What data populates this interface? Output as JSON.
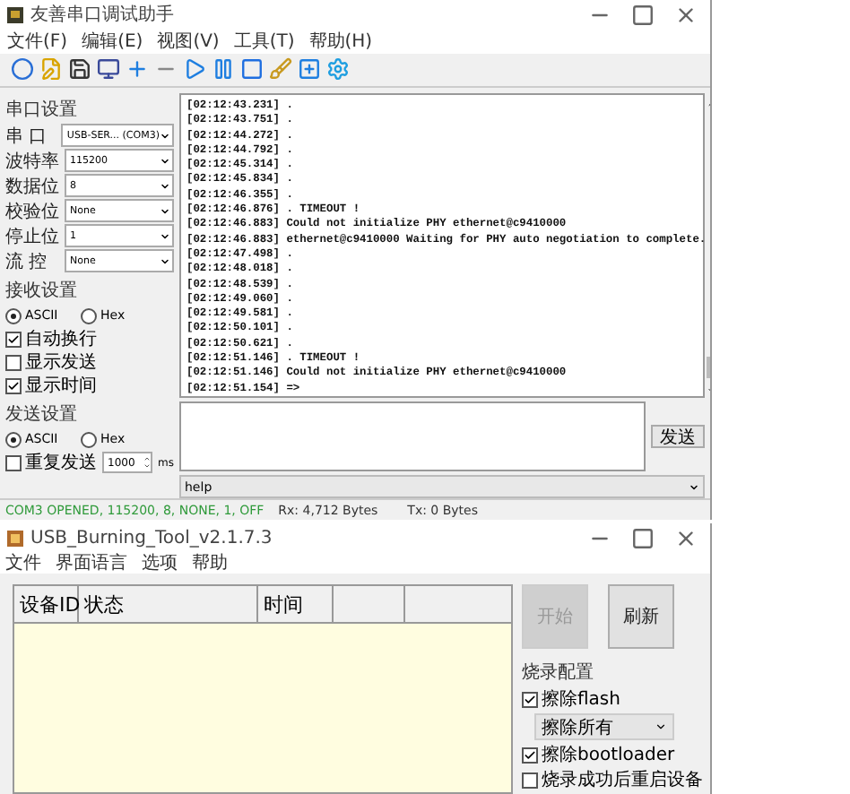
{
  "serial_window": {
    "title": "友善串口调试助手",
    "menu": [
      "文件(F)",
      "编辑(E)",
      "视图(V)",
      "工具(T)",
      "帮助(H)"
    ],
    "port_settings": {
      "title": "串口设置",
      "fields": [
        {
          "label": "串 口",
          "value": "USB-SER... (COM3)"
        },
        {
          "label": "波特率",
          "value": "115200"
        },
        {
          "label": "数据位",
          "value": "8"
        },
        {
          "label": "校验位",
          "value": "None"
        },
        {
          "label": "停止位",
          "value": "1"
        },
        {
          "label": "流 控",
          "value": "None"
        }
      ]
    },
    "receive_settings": {
      "title": "接收设置",
      "modes": [
        {
          "label": "ASCII",
          "selected": true
        },
        {
          "label": "Hex",
          "selected": false
        }
      ],
      "options": [
        {
          "label": "自动换行",
          "checked": true
        },
        {
          "label": "显示发送",
          "checked": false
        },
        {
          "label": "显示时间",
          "checked": true
        }
      ]
    },
    "send_settings": {
      "title": "发送设置",
      "modes": [
        {
          "label": "ASCII",
          "selected": true
        },
        {
          "label": "Hex",
          "selected": false
        }
      ],
      "repeat": {
        "label": "重复发送",
        "checked": false,
        "interval": "1000",
        "unit": "ms"
      }
    },
    "log_lines": [
      "[02:12:43.231] .",
      "[02:12:43.751] .",
      "[02:12:44.272] .",
      "[02:12:44.792] .",
      "[02:12:45.314] .",
      "[02:12:45.834] .",
      "[02:12:46.355] .",
      "[02:12:46.876] . TIMEOUT !",
      "[02:12:46.883] Could not initialize PHY ethernet@c9410000",
      "[02:12:46.883] ethernet@c9410000 Waiting for PHY auto negotiation to complete.",
      "[02:12:47.498] .",
      "[02:12:48.018] .",
      "[02:12:48.539] .",
      "[02:12:49.060] .",
      "[02:12:49.581] .",
      "[02:12:50.101] .",
      "[02:12:50.621] .",
      "[02:12:51.146] . TIMEOUT !",
      "[02:12:51.146] Could not initialize PHY ethernet@c9410000",
      "[02:12:51.154] =>"
    ],
    "send_button": "发送",
    "command": "help",
    "status_bar": {
      "connection": "COM3 OPENED, 115200, 8, NONE, 1, OFF",
      "rx": "Rx: 4,712 Bytes",
      "tx": "Tx: 0 Bytes"
    }
  },
  "burn_window": {
    "title": "USB_Burning_Tool_v2.1.7.3",
    "menu": [
      "文件",
      "界面语言",
      "选项",
      "帮助"
    ],
    "table": {
      "columns": [
        "设备ID",
        "状态",
        "时间"
      ]
    },
    "buttons": [
      {
        "label": "开始",
        "disabled": true
      },
      {
        "label": "刷新",
        "disabled": false
      }
    ],
    "config": {
      "title": "烧录配置",
      "options": [
        {
          "kind": "checkbox",
          "label": "擦除flash",
          "checked": true
        },
        {
          "kind": "select",
          "value": "擦除所有"
        },
        {
          "kind": "checkbox",
          "label": "擦除bootloader",
          "checked": true
        },
        {
          "kind": "checkbox",
          "label": "烧录成功后重启设备",
          "checked": false
        }
      ]
    }
  }
}
